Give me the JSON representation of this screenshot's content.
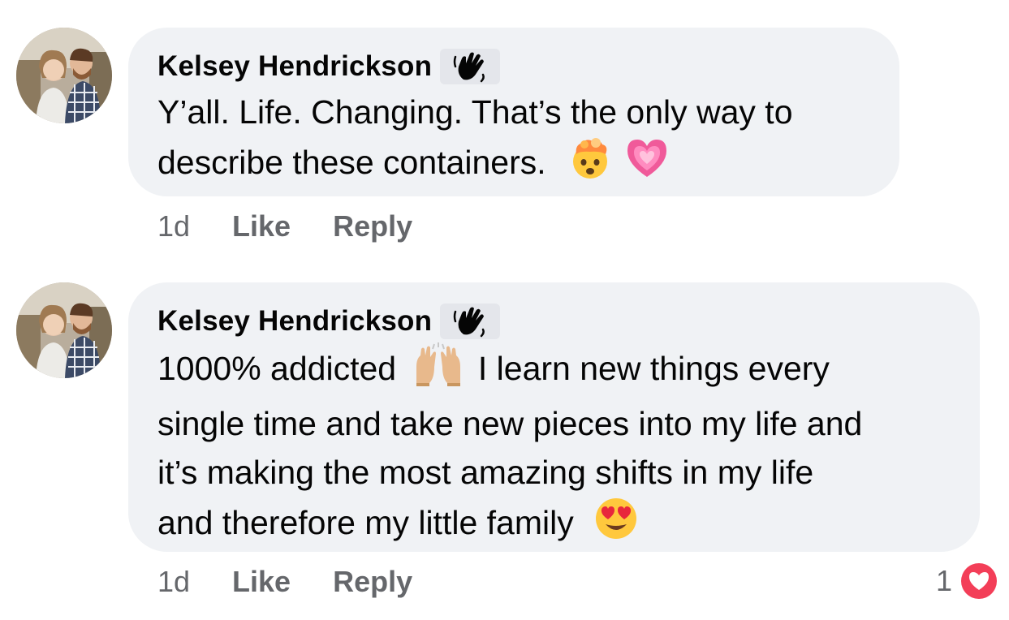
{
  "comments": [
    {
      "author": "Kelsey Hendrickson",
      "badge_icon": "wave-hand-icon",
      "text_parts": [
        "Y’all. Life. Changing. That’s the only way to",
        "describe these containers."
      ],
      "emojis": [
        "mind-blown-emoji",
        "growing-heart-emoji"
      ],
      "time": "1d",
      "like_label": "Like",
      "reply_label": "Reply"
    },
    {
      "author": "Kelsey Hendrickson",
      "badge_icon": "wave-hand-icon",
      "text_parts": {
        "line1a": "1000% addicted",
        "line1b": "I learn new things every",
        "line2": "single time and take new pieces into my life and",
        "line3": "it’s making the most amazing shifts in my life",
        "line4": "and therefore my little family"
      },
      "emojis": [
        "raising-hands-emoji",
        "heart-eyes-emoji"
      ],
      "time": "1d",
      "like_label": "Like",
      "reply_label": "Reply",
      "reaction_count": "1",
      "reaction_icon": "love-heart-icon"
    }
  ],
  "colors": {
    "bubble": "#f0f2f5",
    "meta_text": "#65676b",
    "love_red": "#f33e58"
  }
}
